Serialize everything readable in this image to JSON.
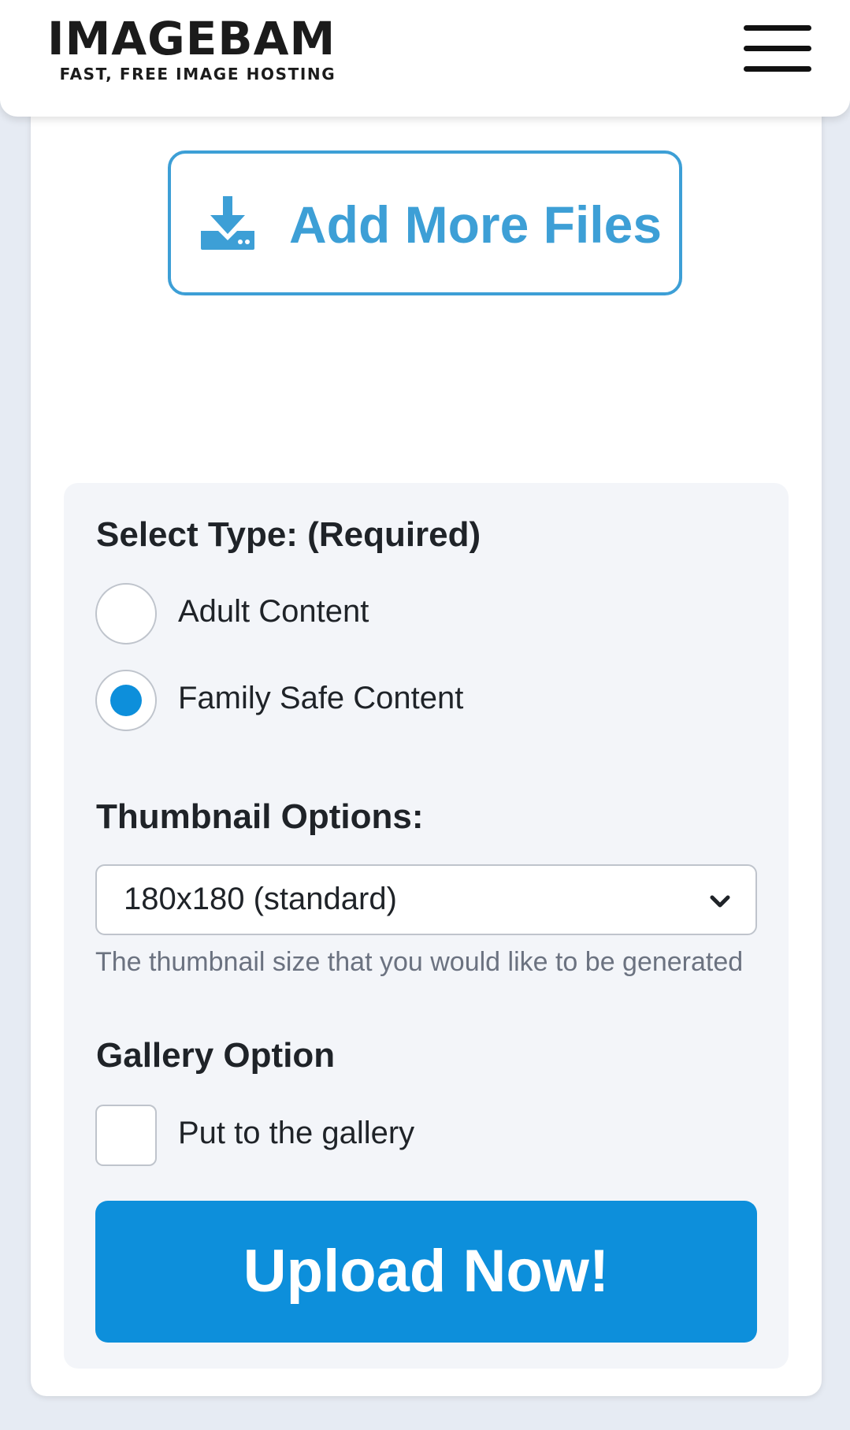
{
  "header": {
    "logo_title": "IMAGEBAM",
    "logo_tagline": "FAST, FREE IMAGE HOSTING",
    "menu_icon": "hamburger-menu-icon"
  },
  "upload": {
    "add_files_label": "Add More Files",
    "add_files_icon": "download-icon"
  },
  "type_section": {
    "title": "Select Type: (Required)",
    "options": [
      {
        "label": "Adult Content",
        "selected": false
      },
      {
        "label": "Family Safe Content",
        "selected": true
      }
    ]
  },
  "thumbnail_section": {
    "title": "Thumbnail Options:",
    "selected_value": "180x180 (standard)",
    "help_text": "The thumbnail size that you would like to be generated"
  },
  "gallery_section": {
    "title": "Gallery Option",
    "checkbox_label": "Put to the gallery",
    "checked": false
  },
  "submit": {
    "label": "Upload Now!"
  },
  "colors": {
    "accent": "#0d8fdb",
    "outline_accent": "#3d9fd6",
    "page_background": "#e6ebf3",
    "panel_background": "#f3f5f9"
  }
}
